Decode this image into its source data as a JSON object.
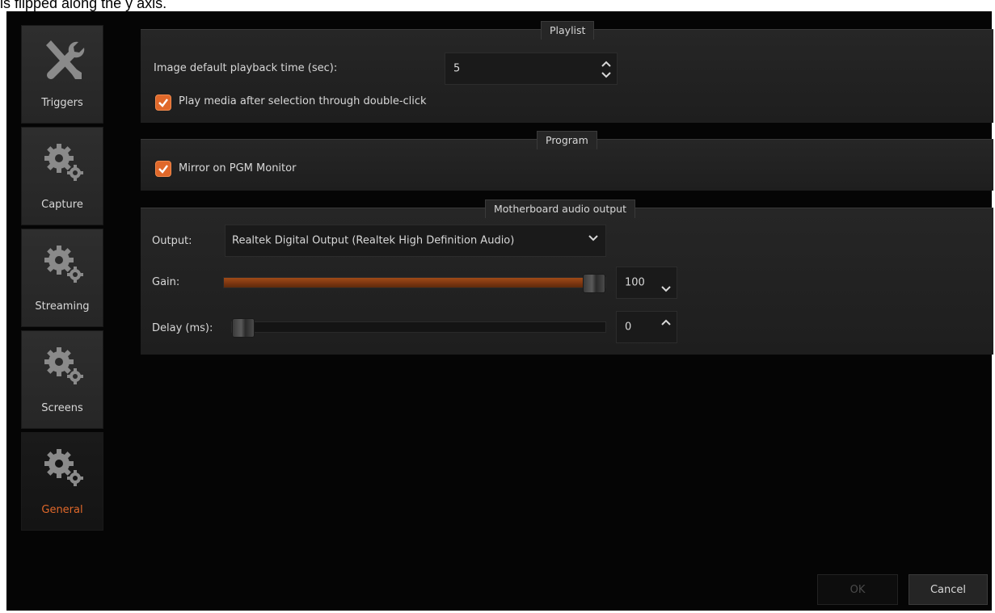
{
  "caption": "is flipped along the y axis.",
  "colors": {
    "accent": "#e0682a",
    "background": "#050505",
    "panel": "#232323"
  },
  "sidebar": {
    "items": [
      {
        "label": "Triggers",
        "icon": "tools-icon",
        "active": false
      },
      {
        "label": "Capture",
        "icon": "gears-icon",
        "active": false
      },
      {
        "label": "Streaming",
        "icon": "gears-icon",
        "active": false
      },
      {
        "label": "Screens",
        "icon": "gears-icon",
        "active": false
      },
      {
        "label": "General",
        "icon": "gears-icon",
        "active": true
      }
    ]
  },
  "playlist": {
    "title": "Playlist",
    "playback_label": "Image default playback time (sec):",
    "playback_value": "5",
    "play_media_label": "Play media after selection through double-click",
    "play_media_checked": true
  },
  "program": {
    "title": "Program",
    "mirror_label": "Mirror on PGM Monitor",
    "mirror_checked": true
  },
  "audio": {
    "title": "Motherboard audio output",
    "output_label": "Output:",
    "output_value": "Realtek Digital Output (Realtek High Definition Audio)",
    "gain_label": "Gain:",
    "gain_value": "100",
    "gain_level": 1.0,
    "delay_label": "Delay (ms):",
    "delay_value": "0",
    "delay_level": 0.0
  },
  "footer": {
    "ok_label": "OK",
    "cancel_label": "Cancel"
  }
}
